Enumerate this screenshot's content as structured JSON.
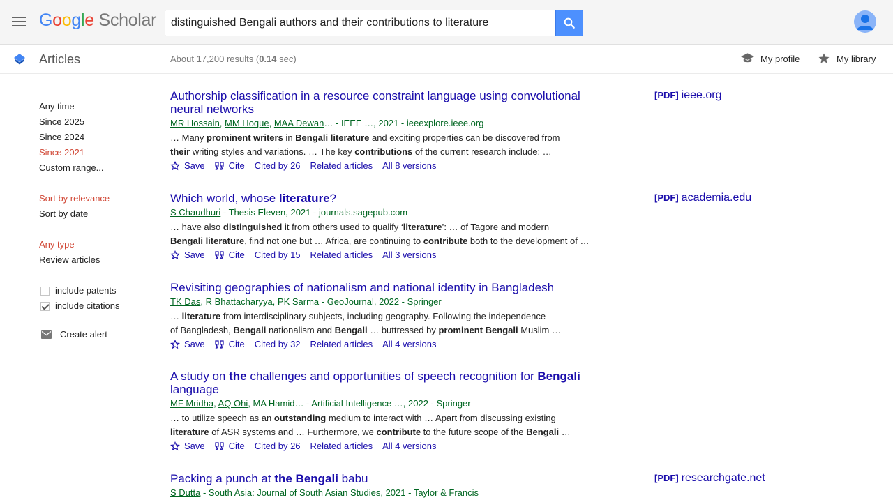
{
  "header": {
    "logo_google": [
      "G",
      "o",
      "o",
      "g",
      "l",
      "e"
    ],
    "logo_scholar": "Scholar",
    "search_value": "distinguished Bengali authors and their contributions to literature"
  },
  "subheader": {
    "section_title": "Articles",
    "results_prefix": "About 17,200 results (",
    "results_time": "0.14",
    "results_suffix": " sec)",
    "my_profile": "My profile",
    "my_library": "My library"
  },
  "sidebar": {
    "time_filters": [
      {
        "label": "Any time",
        "selected": false
      },
      {
        "label": "Since 2025",
        "selected": false
      },
      {
        "label": "Since 2024",
        "selected": false
      },
      {
        "label": "Since 2021",
        "selected": true
      },
      {
        "label": "Custom range...",
        "selected": false
      }
    ],
    "sort": [
      {
        "label": "Sort by relevance",
        "selected": true
      },
      {
        "label": "Sort by date",
        "selected": false
      }
    ],
    "types": [
      {
        "label": "Any type",
        "selected": true
      },
      {
        "label": "Review articles",
        "selected": false
      }
    ],
    "include_patents": {
      "label": "include patents",
      "checked": false
    },
    "include_citations": {
      "label": "include citations",
      "checked": true
    },
    "create_alert": "Create alert"
  },
  "actions": {
    "save": "Save",
    "cite": "Cite",
    "related": "Related articles"
  },
  "results": [
    {
      "title_html": "Authorship classification in a resource constraint language using convolutional neural networks",
      "authors": [
        {
          "name": "MR Hossain",
          "link": true
        },
        {
          "name": ", ",
          "link": false
        },
        {
          "name": "MM Hoque",
          "link": true
        },
        {
          "name": ", ",
          "link": false
        },
        {
          "name": "MAA Dewan",
          "link": true
        },
        {
          "name": "… - IEEE …, 2021 - ieeexplore.ieee.org",
          "link": false
        }
      ],
      "snippet1": "… Many <b>prominent writers</b> in <b>Bengali literature</b> and exciting properties can be discovered from",
      "snippet2": "<b>their</b> writing styles and variations. … The key <b>contributions</b> of the current research include: …",
      "cited_by": "Cited by 26",
      "versions": "All 8 versions",
      "pdf_tag": "[PDF]",
      "pdf_source": "ieee.org"
    },
    {
      "title_html": "Which world, whose <b>literature</b>?",
      "authors": [
        {
          "name": "S Chaudhuri",
          "link": true
        },
        {
          "name": " - Thesis Eleven, 2021 - journals.sagepub.com",
          "link": false
        }
      ],
      "snippet1": "… have also <b>distinguished</b> it from others used to qualify ‘<b>literature</b>’: … of Tagore and modern",
      "snippet2": "<b>Bengali literature</b>, find not one but … Africa, are continuing to <b>contribute</b> both to the development of …",
      "cited_by": "Cited by 15",
      "versions": "All 3 versions",
      "pdf_tag": "[PDF]",
      "pdf_source": "academia.edu"
    },
    {
      "title_html": "Revisiting geographies of nationalism and national identity in Bangladesh",
      "authors": [
        {
          "name": "TK Das",
          "link": true
        },
        {
          "name": ", R Bhattacharyya, PK Sarma - GeoJournal, 2022 - Springer",
          "link": false
        }
      ],
      "snippet1": "… <b>literature</b> from interdisciplinary subjects, including geography. Following the independence",
      "snippet2": "of Bangladesh, <b>Bengali</b> nationalism and <b>Bengali</b> … buttressed by <b>prominent Bengali</b> Muslim …",
      "cited_by": "Cited by 32",
      "versions": "All 4 versions",
      "pdf_tag": "",
      "pdf_source": ""
    },
    {
      "title_html": "A study on <b>the</b> challenges and opportunities of speech recognition for <b>Bengali</b> language",
      "authors": [
        {
          "name": "MF Mridha",
          "link": true
        },
        {
          "name": ", ",
          "link": false
        },
        {
          "name": "AQ Ohi",
          "link": true
        },
        {
          "name": ", MA Hamid… - Artificial Intelligence …, 2022 - Springer",
          "link": false
        }
      ],
      "snippet1": "… to utilize speech as an <b>outstanding</b> medium to interact with … Apart from discussing existing",
      "snippet2": "<b>literature</b> of ASR systems and … Furthermore, we <b>contribute</b> to the future scope of the <b>Bengali</b> …",
      "cited_by": "Cited by 26",
      "versions": "All 4 versions",
      "pdf_tag": "",
      "pdf_source": ""
    },
    {
      "title_html": "Packing a punch at <b>the Bengali</b> babu",
      "authors": [
        {
          "name": "S Dutta",
          "link": true
        },
        {
          "name": " - South Asia: Journal of South Asian Studies, 2021 - Taylor & Francis",
          "link": false
        }
      ],
      "snippet1": "",
      "snippet2": "",
      "cited_by": "",
      "versions": "",
      "pdf_tag": "[PDF]",
      "pdf_source": "researchgate.net"
    }
  ],
  "colors": {
    "link": "#1a0dab",
    "green": "#006621",
    "selected": "#d14836",
    "search_button": "#4d90fe"
  }
}
